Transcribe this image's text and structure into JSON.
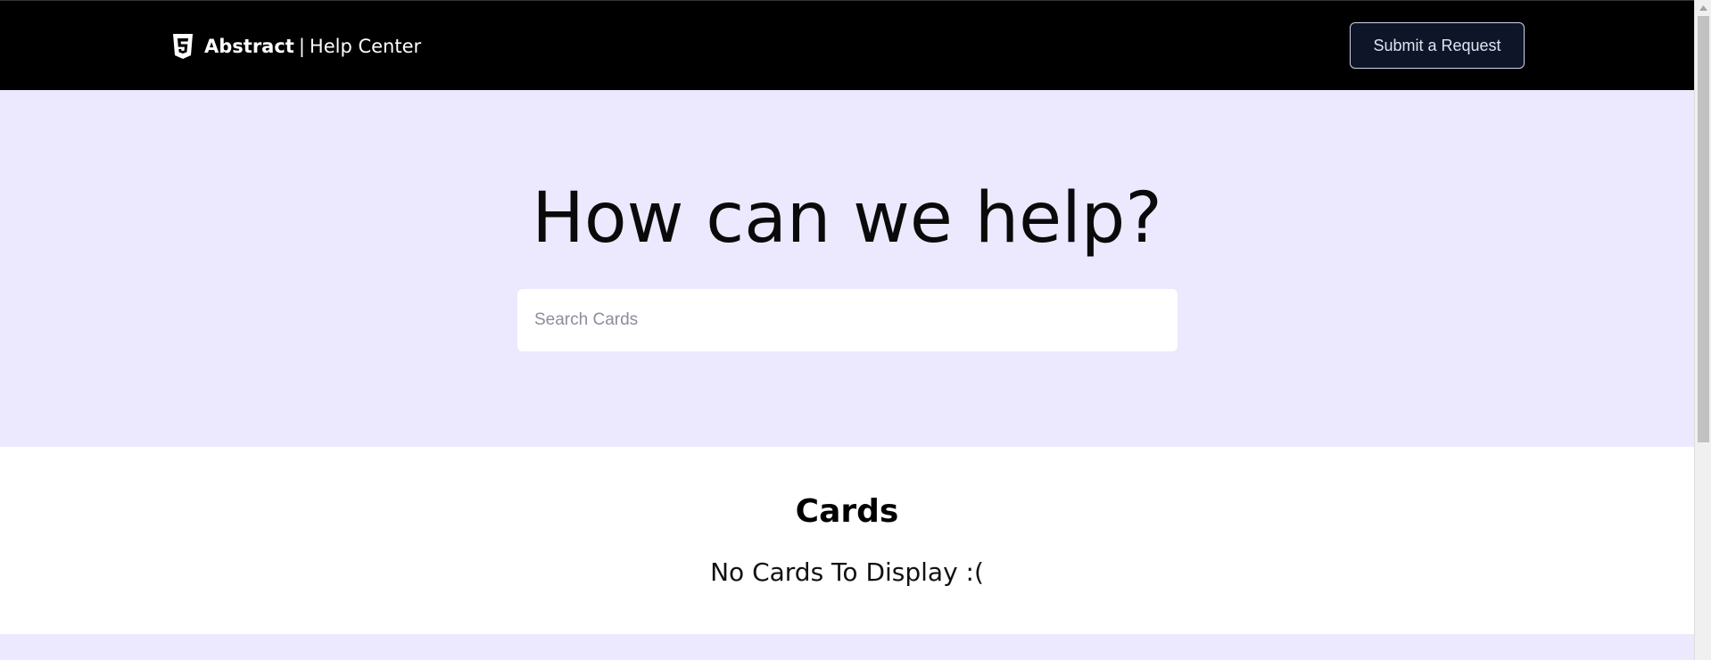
{
  "header": {
    "brand_name": "Abstract",
    "brand_separator": "|",
    "brand_subtitle": "Help Center",
    "logo_icon": "html5-shield-icon",
    "submit_label": "Submit a Request"
  },
  "hero": {
    "title": "How can we help?",
    "search_placeholder": "Search Cards",
    "search_value": ""
  },
  "cards": {
    "title": "Cards",
    "empty_message": "No Cards To Display :("
  },
  "colors": {
    "header_bg": "#000000",
    "hero_bg": "#ece8fe",
    "button_bg": "#0f1528",
    "cards_bg": "#ffffff"
  }
}
